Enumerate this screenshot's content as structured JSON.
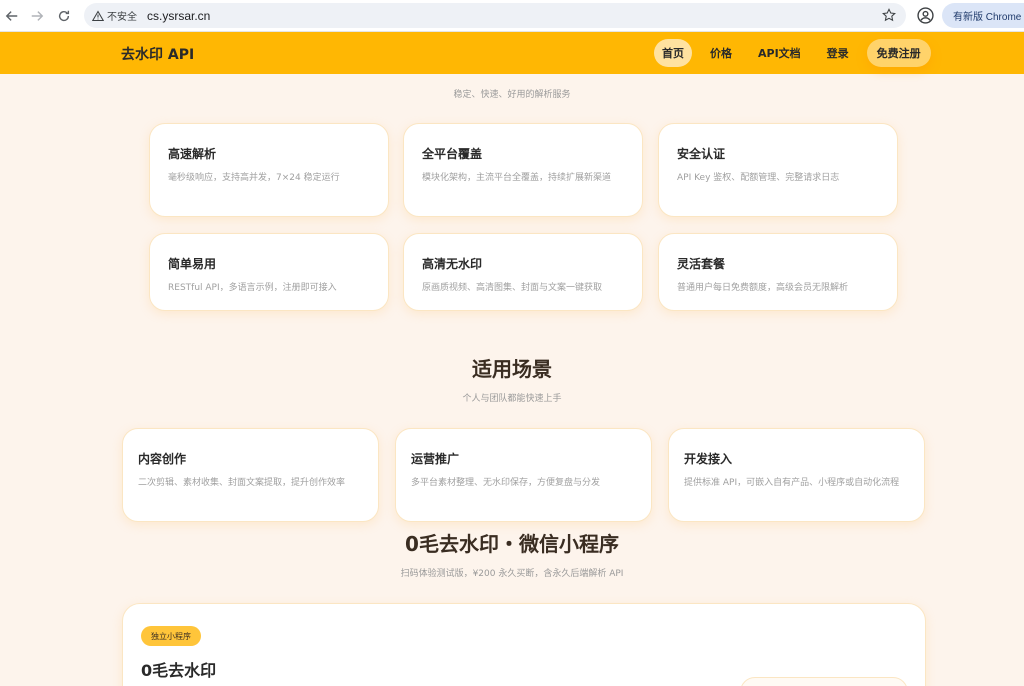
{
  "browser": {
    "security_label": "不安全",
    "url": "cs.ysrsar.cn",
    "update_label": "有新版 Chrome 可"
  },
  "header": {
    "logo": "去水印 API",
    "nav": [
      {
        "label": "首页",
        "active": true
      },
      {
        "label": "价格"
      },
      {
        "label": "API文档"
      },
      {
        "label": "登录"
      },
      {
        "label": "免费注册",
        "cta": true
      }
    ]
  },
  "features": {
    "subtitle": "稳定、快速、好用的解析服务",
    "cards": [
      {
        "title": "高速解析",
        "desc": "毫秒级响应，支持高并发，7×24 稳定运行"
      },
      {
        "title": "全平台覆盖",
        "desc": "模块化架构，主流平台全覆盖，持续扩展新渠道"
      },
      {
        "title": "安全认证",
        "desc": "API Key 鉴权、配额管理、完整请求日志"
      },
      {
        "title": "简单易用",
        "desc": "RESTful API，多语言示例，注册即可接入"
      },
      {
        "title": "高清无水印",
        "desc": "原画质视频、高清图集、封面与文案一键获取"
      },
      {
        "title": "灵活套餐",
        "desc": "普通用户每日免费额度，高级会员无限解析"
      }
    ]
  },
  "scenarios": {
    "title": "适用场景",
    "subtitle": "个人与团队都能快速上手",
    "cards": [
      {
        "title": "内容创作",
        "desc": "二次剪辑、素材收集、封面文案提取，提升创作效率"
      },
      {
        "title": "运营推广",
        "desc": "多平台素材整理、无水印保存，方便复盘与分发"
      },
      {
        "title": "开发接入",
        "desc": "提供标准 API，可嵌入自有产品、小程序或自动化流程"
      }
    ]
  },
  "miniprogram": {
    "title": "0毛去水印・微信小程序",
    "subtitle": "扫码体验测试版，¥200 永久买断，含永久后端解析 API",
    "badge": "独立小程序",
    "card_title": "0毛去水印"
  }
}
